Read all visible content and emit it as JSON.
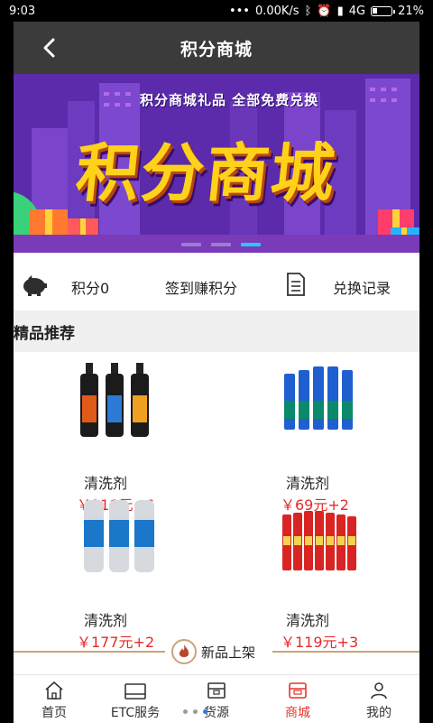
{
  "status_bar": {
    "time": "9:03",
    "network_speed": "0.00K/s",
    "signal": "4G",
    "battery": "21%"
  },
  "header": {
    "title": "积分商城",
    "back_icon": "back-arrow-icon"
  },
  "banner": {
    "subtitle": "积分商城礼品 全部免费兑换",
    "headline": "积分商城",
    "page_count": 3,
    "active_page": 3
  },
  "points_bar": {
    "points_label": "积分0",
    "signin_label": "签到赚积分",
    "record_label": "兑换记录"
  },
  "section": {
    "title": "精品推荐"
  },
  "products": [
    {
      "name": "清洗剂",
      "price": "￥118元+6"
    },
    {
      "name": "清洗剂",
      "price": "￥69元+2"
    },
    {
      "name": "清洗剂",
      "price": "￥177元+2"
    },
    {
      "name": "清洗剂",
      "price": "￥119元+3"
    }
  ],
  "new_arrivals": {
    "label": "新品上架"
  },
  "bottom_nav": {
    "items": [
      {
        "label": "首页",
        "icon": "home-icon",
        "active": false
      },
      {
        "label": "ETC服务",
        "icon": "card-icon",
        "active": false
      },
      {
        "label": "货源",
        "icon": "cargo-icon",
        "active": false
      },
      {
        "label": "商城",
        "icon": "shop-icon",
        "active": true
      },
      {
        "label": "我的",
        "icon": "user-icon",
        "active": false
      }
    ]
  },
  "colors": {
    "header_bg": "#3b3b3b",
    "price": "#e52a2a",
    "active_nav": "#e5342a",
    "banner_purple": "#5a2aa8",
    "headline_yellow": "#ffd21a",
    "divider_gold": "#c9a57a"
  }
}
